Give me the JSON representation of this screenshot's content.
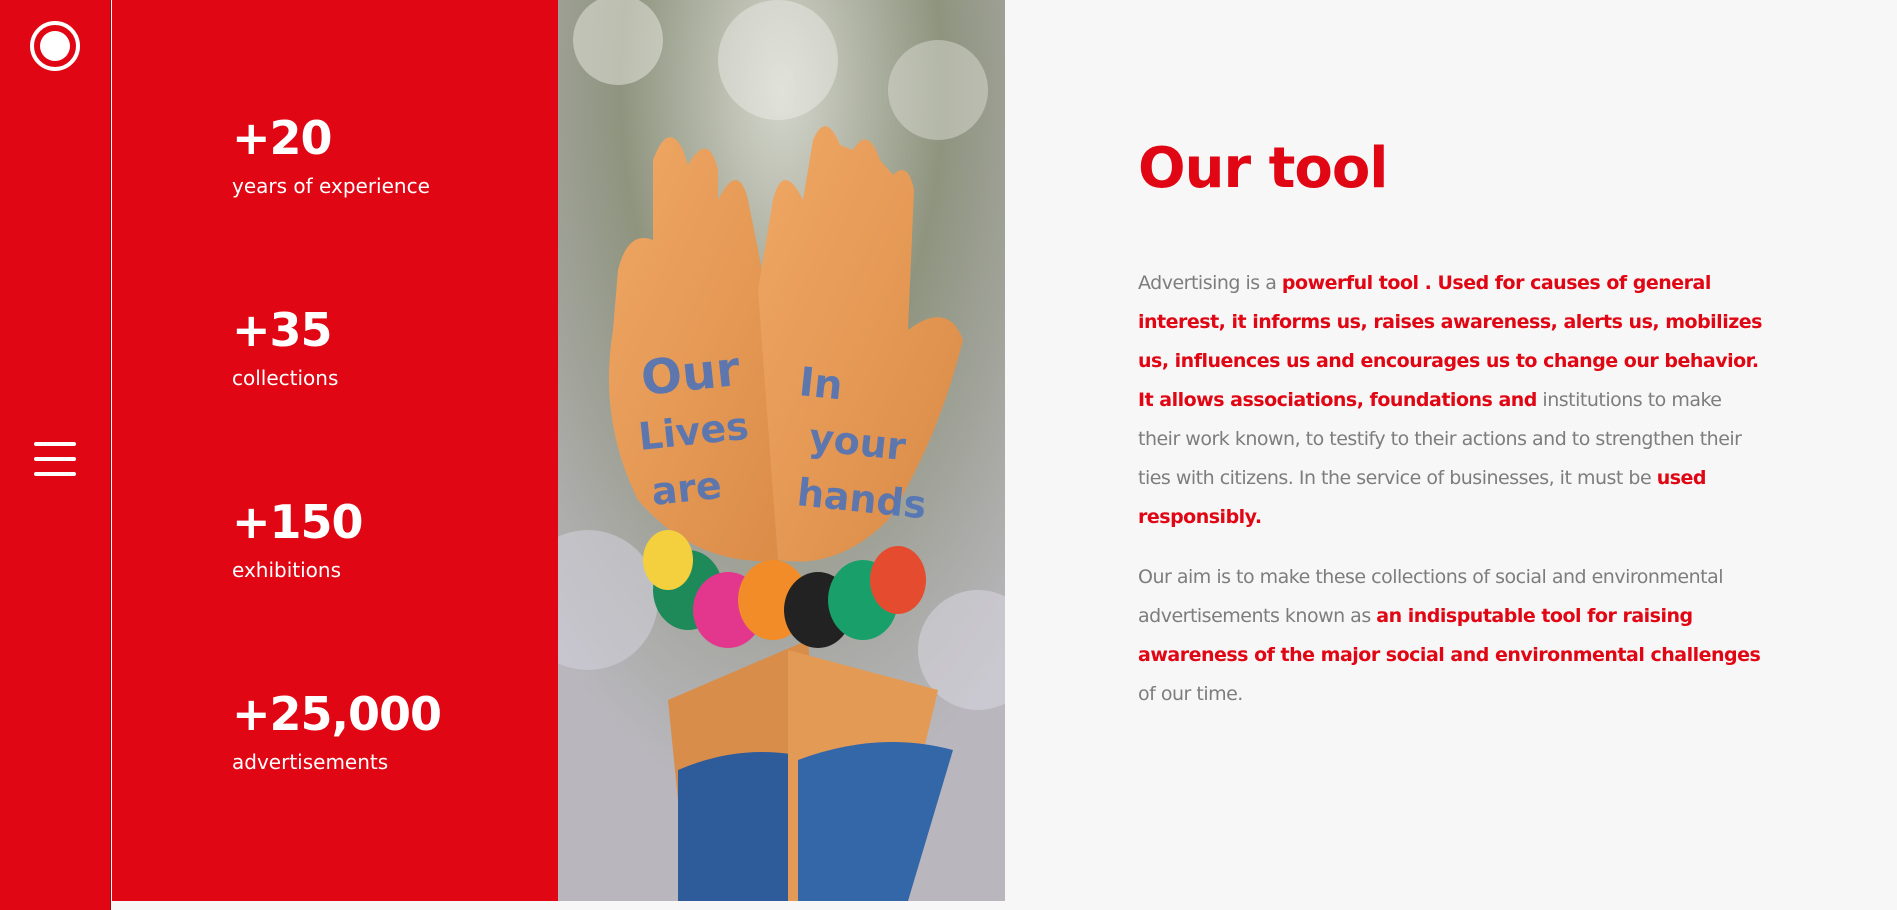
{
  "colors": {
    "brand_red": "#e10613",
    "background": "#f7f7f7",
    "body_text": "#7d7d7d",
    "white": "#ffffff"
  },
  "rail": {
    "logo_icon": "circle-logo-icon",
    "menu_icon": "hamburger-menu-icon"
  },
  "stats": [
    {
      "value": "+20",
      "label": "years of experience"
    },
    {
      "value": "+35",
      "label": "collections"
    },
    {
      "value": "+150",
      "label": "exhibitions"
    },
    {
      "value": "+25,000",
      "label": "advertisements"
    }
  ],
  "image": {
    "palm_text_left": [
      "Our",
      "Lives",
      "are"
    ],
    "palm_text_right": [
      "In",
      "your",
      "hands"
    ]
  },
  "section": {
    "title": "Our tool",
    "paragraph1": {
      "t1": "Advertising is a ",
      "b1": "powerful tool . Used for causes of general interest, it informs us, raises awareness, alerts us, mobilizes us, influences us and encourages us to change our behavior. It allows associations, foundations and",
      "t2": " institutions to make their work known, to testify to their actions and to strengthen their ties with citizens. In the service of businesses, it must be ",
      "b2": "used responsibly."
    },
    "paragraph2": {
      "t1": "Our aim is to make these collections of social and environmental advertisements known as ",
      "b1": "an indisputable tool for raising awareness of the major social and environmental challenges",
      "t2": " of our time."
    }
  }
}
